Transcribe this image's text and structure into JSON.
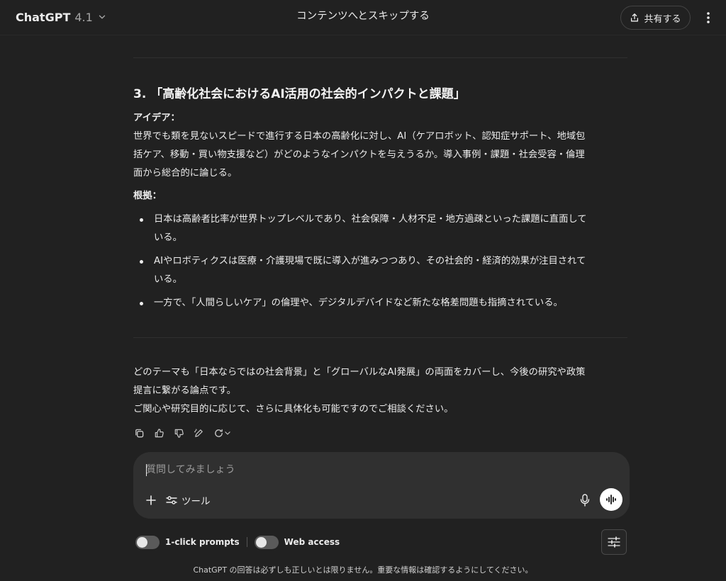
{
  "header": {
    "model_name": "ChatGPT",
    "model_version": "4.1",
    "skip_link": "コンテンツへとスキップする",
    "share_label": "共有する"
  },
  "message": {
    "section_title": "3. 「高齢化社会におけるAI活用の社会的インパクトと課題」",
    "idea_label": "アイデア：",
    "idea_line1": "世界でも類を見ないスピードで進行する日本の高齢化に対し、AI（ケアロボット、認知症サポート、地域包",
    "idea_line2": "括ケア、移動・買い物支援など）がどのようなインパクトを与えうるか。導入事例・課題・社会受容・倫理",
    "idea_line3": "面から総合的に論じる。",
    "basis_label": "根拠：",
    "bullets": [
      {
        "line1": "日本は高齢者比率が世界トップレベルであり、社会保障・人材不足・地方過疎といった課題に直面して",
        "line2": "いる。"
      },
      {
        "line1": "AIやロボティクスは医療・介護現場で既に導入が進みつつあり、その社会的・経済的効果が注目されて",
        "line2": "いる。"
      },
      {
        "line1": "一方で、「人間らしいケア」の倫理や、デジタルデバイドなど新たな格差問題も指摘されている。",
        "line2": ""
      }
    ],
    "closing_line1": "どのテーマも「日本ならではの社会背景」と「グローバルなAI発展」の両面をカバーし、今後の研究や政策",
    "closing_line2": "提言に繋がる論点です。",
    "closing_line3": "ご関心や研究目的に応じて、さらに具体化も可能ですのでご相談ください。"
  },
  "actions": {
    "icons": [
      "copy-icon",
      "thumbs-up-icon",
      "thumbs-down-icon",
      "edit-canvas-icon",
      "regenerate-icon"
    ]
  },
  "composer": {
    "placeholder": "質問してみましょう",
    "value": "",
    "tools_label": "ツール"
  },
  "toggles": {
    "one_click_label": "1-click prompts",
    "web_access_label": "Web access",
    "one_click_on": false,
    "web_access_on": false
  },
  "footer": {
    "disclaimer": "ChatGPT の回答は必ずしも正しいとは限りません。重要な情報は確認するようにしてください。"
  },
  "colors": {
    "background": "#212121",
    "composer": "#303030",
    "text": "#ececec"
  }
}
